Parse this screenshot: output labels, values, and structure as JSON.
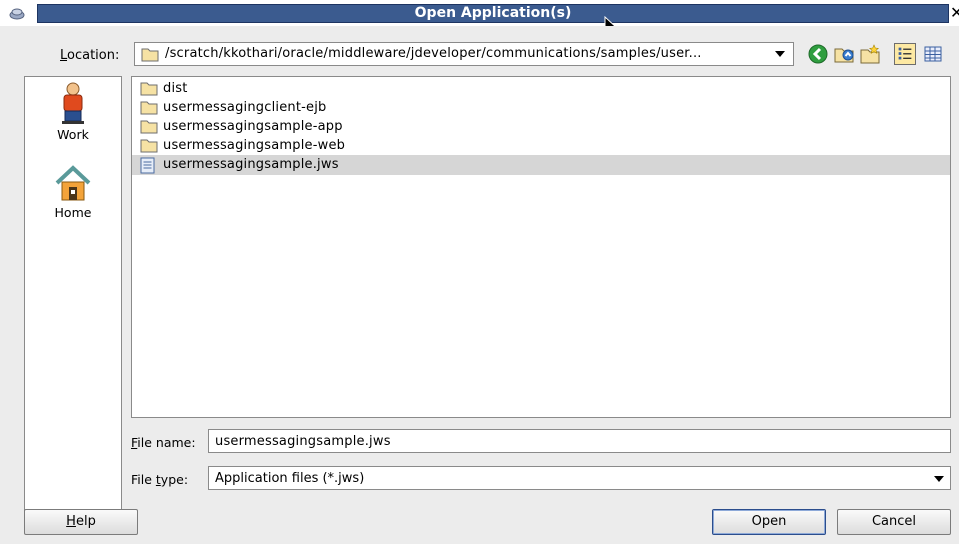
{
  "window": {
    "title": "Open Application(s)",
    "close_glyph": "✕"
  },
  "location": {
    "label_prefix": "",
    "label_mnemonic": "L",
    "label_rest": "ocation:",
    "path": "/scratch/kkothari/oracle/middleware/jdeveloper/communications/samples/user..."
  },
  "toolbar": {
    "icons": [
      "back-icon",
      "up-folder-icon",
      "new-folder-icon",
      "list-view-icon",
      "details-view-icon"
    ]
  },
  "places": [
    {
      "label": "Work",
      "icon": "user-icon"
    },
    {
      "label": "Home",
      "icon": "home-icon"
    }
  ],
  "files": [
    {
      "name": "dist",
      "type": "folder"
    },
    {
      "name": "usermessagingclient-ejb",
      "type": "folder"
    },
    {
      "name": "usermessagingsample-app",
      "type": "folder"
    },
    {
      "name": "usermessagingsample-web",
      "type": "folder"
    },
    {
      "name": "usermessagingsample.jws",
      "type": "file",
      "selected": true
    }
  ],
  "filename": {
    "label_mnemonic": "F",
    "label_rest": "ile name:",
    "value": "usermessagingsample.jws"
  },
  "filetype": {
    "label_prefix": "File ",
    "label_mnemonic": "t",
    "label_rest": "ype:",
    "value": "Application files (*.jws)"
  },
  "buttons": {
    "help_mnemonic": "H",
    "help_rest": "elp",
    "open": "Open",
    "cancel": "Cancel"
  },
  "colors": {
    "title_bar": "#3b5b8f",
    "selection": "#d6d6d6",
    "dialog_bg": "#ececec"
  }
}
